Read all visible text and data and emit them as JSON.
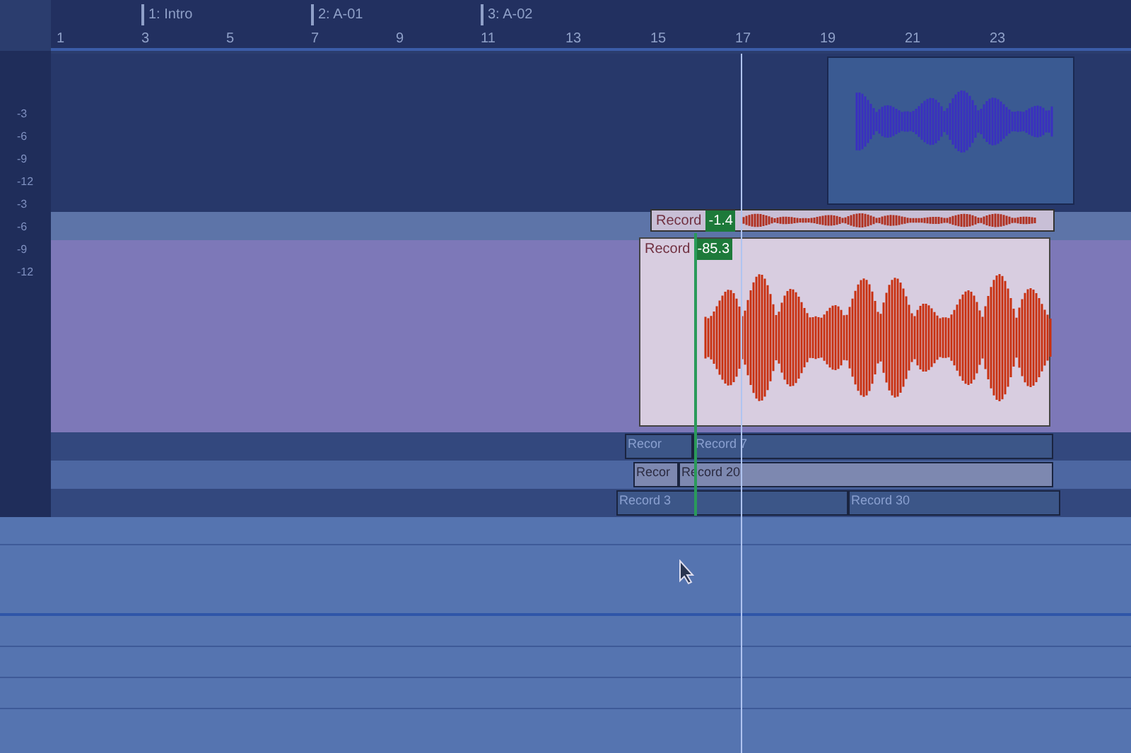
{
  "ruler": {
    "numbers": [
      "1",
      "3",
      "5",
      "7",
      "9",
      "11",
      "13",
      "15",
      "17",
      "19",
      "21",
      "23"
    ],
    "markers": [
      {
        "label": "1: Intro"
      },
      {
        "label": "2: A-01"
      },
      {
        "label": "3: A-02"
      }
    ]
  },
  "meter_scale": [
    "-3",
    "-6",
    "-9",
    "-12",
    "-3",
    "-6",
    "-9",
    "-12"
  ],
  "take_header": {
    "label": "Record",
    "value": "-1.4"
  },
  "main_clip": {
    "label": "Record",
    "value": "-85.3"
  },
  "lanes": [
    {
      "clips": [
        {
          "label": "Recor"
        },
        {
          "label": "Record 7"
        }
      ]
    },
    {
      "clips": [
        {
          "label": "Recor"
        },
        {
          "label": "Record 20"
        }
      ]
    },
    {
      "clips": [
        {
          "label": "Record 3"
        },
        {
          "label": "Record 30"
        }
      ]
    }
  ]
}
